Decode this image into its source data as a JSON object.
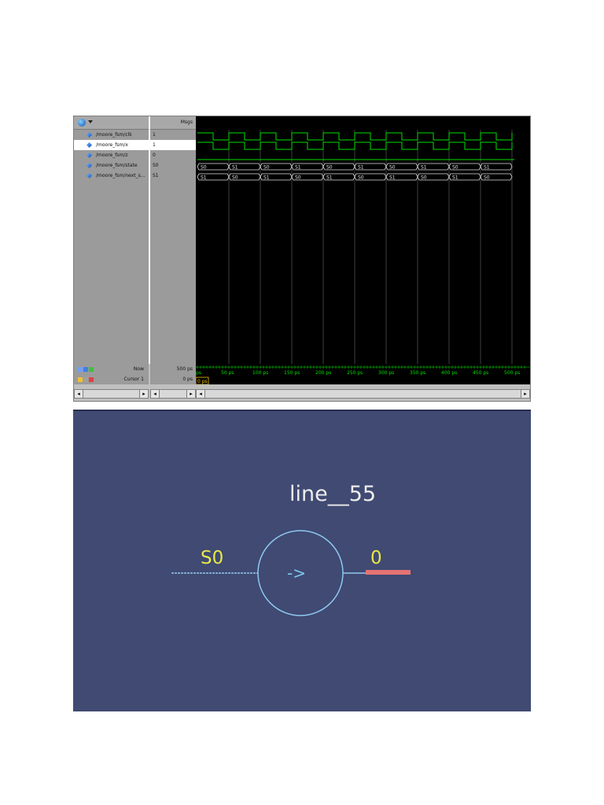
{
  "waveform": {
    "msgs_header": "Msgs",
    "signals": [
      {
        "name": "/moore_fsm/clk",
        "value": "1",
        "selected": false
      },
      {
        "name": "/moore_fsm/x",
        "value": "1",
        "selected": true
      },
      {
        "name": "/moore_fsm/z",
        "value": "0",
        "selected": false
      },
      {
        "name": "/moore_fsm/state",
        "value": "S0",
        "selected": false
      },
      {
        "name": "/moore_fsm/next_s...",
        "value": "S1",
        "selected": false
      }
    ],
    "state_bus": [
      "S0",
      "S1",
      "S0",
      "S1",
      "S0",
      "S1",
      "S0",
      "S1",
      "S0",
      "S1"
    ],
    "next_state_bus": [
      "S1",
      "S0",
      "S1",
      "S0",
      "S1",
      "S0",
      "S1",
      "S0",
      "S1",
      "S0"
    ],
    "now_label": "Now",
    "now_value": "500 ps",
    "cursor_label": "Cursor 1",
    "cursor_value": "0 ps",
    "cursor_marker": "0 ps",
    "time_ticks": [
      "ps",
      "50 ps",
      "100 ps",
      "150 ps",
      "200 ps",
      "250 ps",
      "300 ps",
      "350 ps",
      "400 ps",
      "450 ps",
      "500 ps"
    ],
    "colors": {
      "wave": "#00e000",
      "bus": "#e0e0e0",
      "cursor": "#f0c000"
    }
  },
  "schematic": {
    "title": "line__55",
    "input_label": "S0",
    "output_label": "0",
    "operator": "->",
    "colors": {
      "background": "#404a72",
      "label": "#e8e84a",
      "circle": "#7fc8f0",
      "output_bar": "#e57373"
    }
  }
}
